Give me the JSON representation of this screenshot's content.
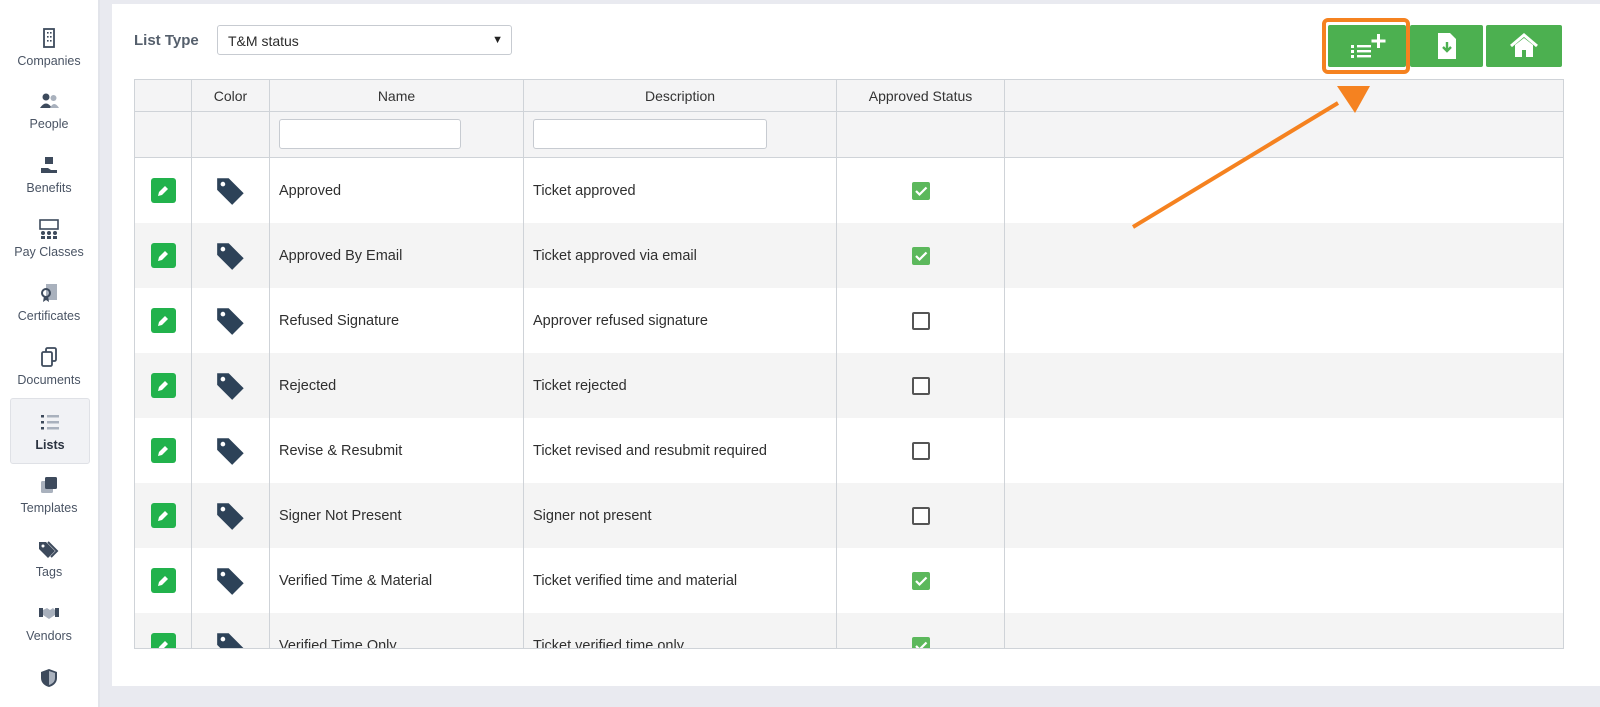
{
  "sidebar": {
    "items": [
      {
        "label": "Companies",
        "icon": "building-icon"
      },
      {
        "label": "People",
        "icon": "people-icon"
      },
      {
        "label": "Benefits",
        "icon": "benefits-icon"
      },
      {
        "label": "Pay Classes",
        "icon": "pay-classes-icon"
      },
      {
        "label": "Certificates",
        "icon": "certificate-icon"
      },
      {
        "label": "Documents",
        "icon": "documents-icon"
      },
      {
        "label": "Lists",
        "icon": "list-icon",
        "active": true
      },
      {
        "label": "Templates",
        "icon": "templates-icon"
      },
      {
        "label": "Tags",
        "icon": "tags-icon"
      },
      {
        "label": "Vendors",
        "icon": "handshake-icon"
      }
    ]
  },
  "toolbar": {
    "list_type_label": "List Type",
    "list_type_value": "T&M status",
    "buttons": [
      {
        "icon": "add-list-item-icon"
      },
      {
        "icon": "download-file-icon"
      },
      {
        "icon": "home-icon"
      }
    ]
  },
  "table": {
    "columns": [
      "",
      "Color",
      "Name",
      "Description",
      "Approved Status"
    ],
    "rows": [
      {
        "name": "Approved",
        "description": "Ticket approved",
        "approved": true
      },
      {
        "name": "Approved By Email",
        "description": "Ticket approved via email",
        "approved": true
      },
      {
        "name": "Refused Signature",
        "description": "Approver refused signature",
        "approved": false
      },
      {
        "name": "Rejected",
        "description": "Ticket rejected",
        "approved": false
      },
      {
        "name": "Revise & Resubmit",
        "description": "Ticket revised and resubmit required",
        "approved": false
      },
      {
        "name": "Signer Not Present",
        "description": "Signer not present",
        "approved": false
      },
      {
        "name": "Verified Time & Material",
        "description": "Ticket verified time and material",
        "approved": true
      },
      {
        "name": "Verified Time Only",
        "description": "Ticket verified time only",
        "approved": true
      }
    ]
  },
  "colors": {
    "button_green": "#4cb050",
    "edit_green": "#22b24c",
    "check_green": "#5cb85c",
    "tag_navy": "#2d4258",
    "highlight_orange": "#f58220"
  }
}
